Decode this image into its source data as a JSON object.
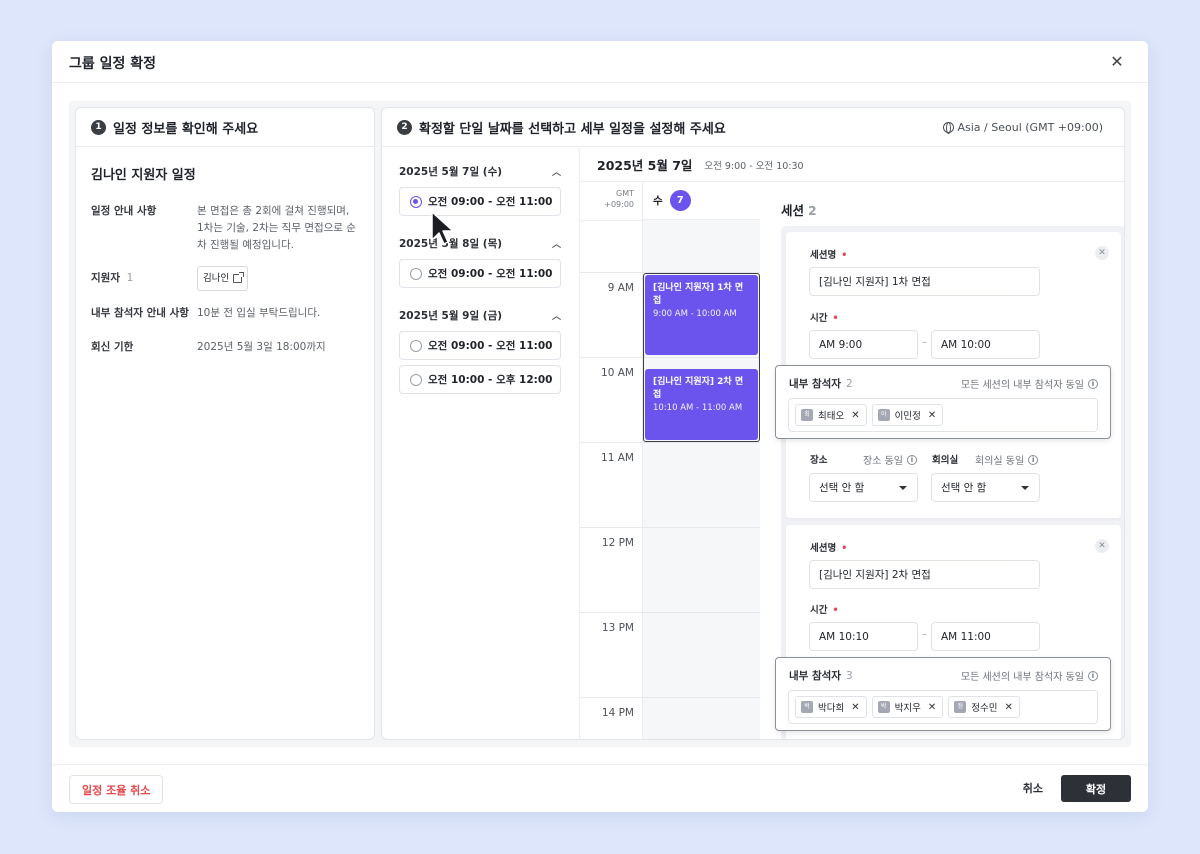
{
  "modal": {
    "title": "그룹 일정 확정",
    "close_icon": "close-icon"
  },
  "left_panel": {
    "step": "1",
    "heading": "일정 정보를 확인해 주세요",
    "title": "김나인 지원자 일정",
    "rows": [
      {
        "label": "일정 안내 사항",
        "value": "본 면접은 총 2회에 걸쳐 진행되며, 1차는 기술, 2차는 직무 면접으로 순차 진행될 예정입니다."
      },
      {
        "label": "지원자",
        "count": "1",
        "value": "김나인"
      },
      {
        "label": "내부 참석자 안내 사항",
        "value": "10분 전 입실 부탁드립니다."
      },
      {
        "label": "회신 기한",
        "value": "2025년 5월 3일 18:00까지"
      }
    ]
  },
  "right_panel": {
    "step": "2",
    "heading": "확정할 단일 날짜를 선택하고 세부 일정을 설정해 주세요",
    "timezone": "Asia / Seoul (GMT +09:00)",
    "date_groups": [
      {
        "date": "2025년 5월 7일 (수)",
        "slots": [
          {
            "label": "오전 09:00 - 오전 11:00",
            "checked": true
          }
        ]
      },
      {
        "date": "2025년 5월 8일 (목)",
        "slots": [
          {
            "label": "오전 09:00 - 오전 11:00",
            "checked": false
          }
        ]
      },
      {
        "date": "2025년 5월 9일 (금)",
        "slots": [
          {
            "label": "오전 09:00 - 오전 11:00",
            "checked": false
          },
          {
            "label": "오전 10:00 - 오후 12:00",
            "checked": false
          }
        ]
      }
    ],
    "calendar": {
      "date": "2025년 5월 7일",
      "range": "오전 9:00 - 오전 10:30",
      "weekday": "수",
      "day": "7",
      "gmt": "GMT\n+09:00",
      "hours": [
        "9 AM",
        "10 AM",
        "11 AM",
        "12 PM",
        "13 PM",
        "14 PM"
      ],
      "events": [
        {
          "title": "[김나인 지원자] 1차 면접",
          "time": "9:00 AM - 10:00 AM"
        },
        {
          "title": "[김나인 지원자] 2차 면접",
          "time": "10:10 AM - 11:00 AM"
        }
      ]
    },
    "sessions": {
      "label": "세션",
      "count": "2",
      "items": [
        {
          "name_label": "세션명",
          "name": "[김나인 지원자] 1차 면접",
          "time_label": "시간",
          "start": "AM 9:00",
          "end": "AM 10:00",
          "participants_label": "내부 참석자",
          "participants_count": "2",
          "participants_hint": "모든 세션의 내부 참석자 동일",
          "participants": [
            {
              "avatar": "최",
              "name": "최태오"
            },
            {
              "avatar": "이",
              "name": "이민정"
            }
          ],
          "place_label": "장소",
          "place_hint": "장소 동일",
          "place_value": "선택 안 함",
          "room_label": "회의실",
          "room_hint": "회의실 동일",
          "room_value": "선택 안 함"
        },
        {
          "name_label": "세션명",
          "name": "[김나인 지원자] 2차 면접",
          "time_label": "시간",
          "start": "AM 10:10",
          "end": "AM 11:00",
          "participants_label": "내부 참석자",
          "participants_count": "3",
          "participants_hint": "모든 세션의 내부 참석자 동일",
          "participants": [
            {
              "avatar": "박",
              "name": "박다희"
            },
            {
              "avatar": "박",
              "name": "박지우"
            },
            {
              "avatar": "정",
              "name": "정수민"
            }
          ]
        }
      ]
    }
  },
  "footer": {
    "cancel_schedule": "일정 조율 취소",
    "cancel": "취소",
    "confirm": "확정"
  },
  "colors": {
    "accent": "#6b53ee",
    "danger": "#e5484d",
    "dark_button": "#2d3037",
    "page_bg": "#dde6fb"
  }
}
